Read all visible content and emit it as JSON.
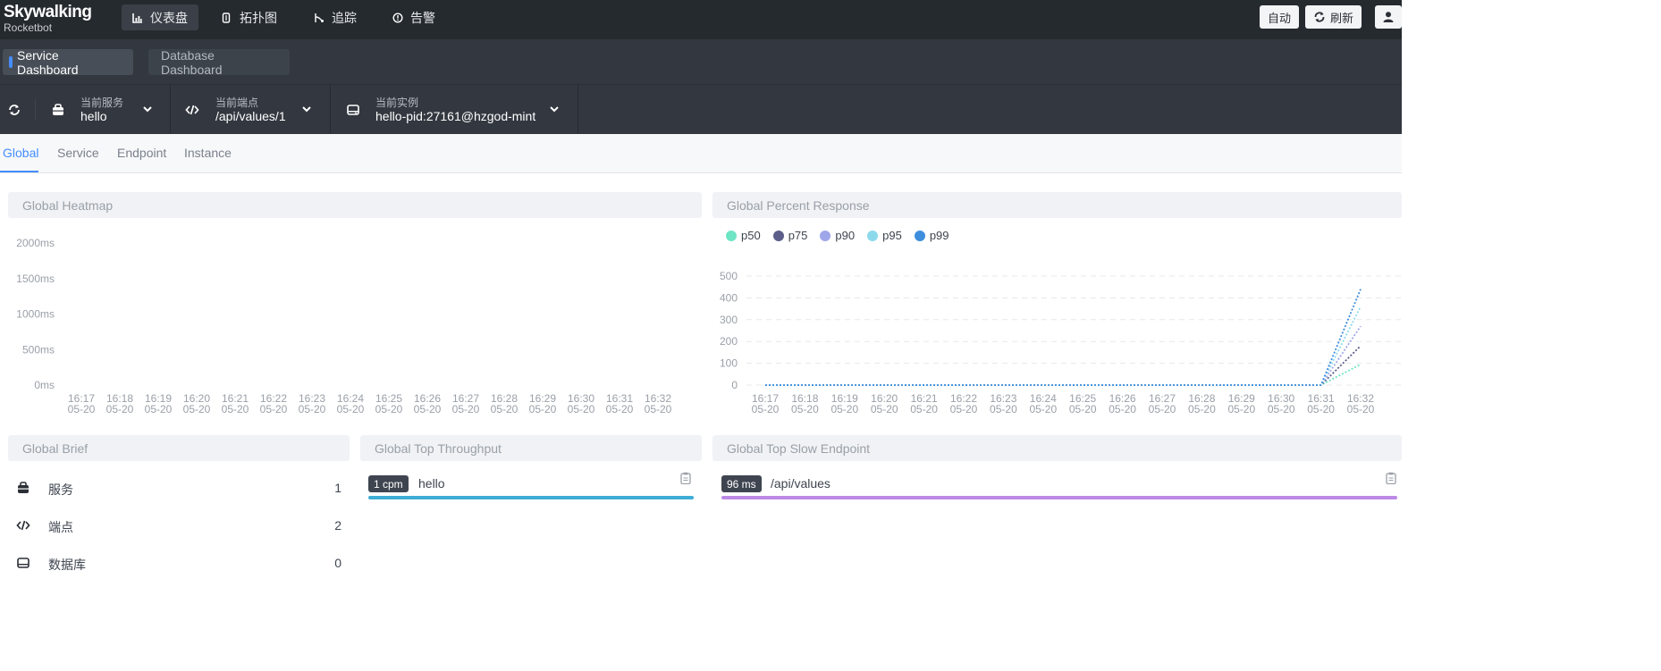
{
  "app": {
    "brand": "Skywalking",
    "subtitle": "Rocketbot"
  },
  "nav": {
    "items": [
      {
        "label": "仪表盘",
        "icon": "dashboard-icon",
        "active": true
      },
      {
        "label": "拓扑图",
        "icon": "topology-icon",
        "active": false
      },
      {
        "label": "追踪",
        "icon": "trace-icon",
        "active": false
      },
      {
        "label": "告警",
        "icon": "alarm-icon",
        "active": false
      }
    ],
    "auto_label": "自动",
    "refresh_label": "刷新"
  },
  "dashboards": {
    "tabs": [
      "Service Dashboard",
      "Database Dashboard"
    ],
    "active": 0
  },
  "selectors": {
    "service": {
      "label": "当前服务",
      "value": "hello"
    },
    "endpoint": {
      "label": "当前端点",
      "value": "/api/values/1"
    },
    "instance": {
      "label": "当前实例",
      "value": "hello-pid:27161@hzgod-mint"
    }
  },
  "subtabs": [
    "Global",
    "Service",
    "Endpoint",
    "Instance"
  ],
  "panels": {
    "heatmap_title": "Global Heatmap",
    "percent_title": "Global Percent Response",
    "brief_title": "Global Brief",
    "throughput_title": "Global Top Throughput",
    "slow_title": "Global Top Slow Endpoint"
  },
  "colors": {
    "p50": "#6ee5c4",
    "p75": "#5b5e8a",
    "p90": "#9fa6e9",
    "p95": "#8dd9ec",
    "p99": "#3e8ede",
    "throughput_bar": "#3eaed6",
    "slow_bar": "#bc8ae6",
    "accent": "#448dfe"
  },
  "chart_data": [
    {
      "type": "heatmap",
      "title": "Global Heatmap",
      "y_ticks": [
        "2000ms",
        "1500ms",
        "1000ms",
        "500ms",
        "0ms"
      ],
      "x_times": [
        "16:17",
        "16:18",
        "16:19",
        "16:20",
        "16:21",
        "16:22",
        "16:23",
        "16:24",
        "16:25",
        "16:26",
        "16:27",
        "16:28",
        "16:29",
        "16:30",
        "16:31",
        "16:32"
      ],
      "x_date": "05-20",
      "values": []
    },
    {
      "type": "line",
      "title": "Global Percent Response",
      "x_times": [
        "16:17",
        "16:18",
        "16:19",
        "16:20",
        "16:21",
        "16:22",
        "16:23",
        "16:24",
        "16:25",
        "16:26",
        "16:27",
        "16:28",
        "16:29",
        "16:30",
        "16:31",
        "16:32"
      ],
      "x_date": "05-20",
      "ylim": [
        0,
        500
      ],
      "y_ticks": [
        0,
        100,
        200,
        300,
        400,
        500
      ],
      "series": [
        {
          "name": "p50",
          "values": [
            0,
            0,
            0,
            0,
            0,
            0,
            0,
            0,
            0,
            0,
            0,
            0,
            0,
            0,
            0,
            95
          ]
        },
        {
          "name": "p75",
          "values": [
            0,
            0,
            0,
            0,
            0,
            0,
            0,
            0,
            0,
            0,
            0,
            0,
            0,
            0,
            0,
            180
          ]
        },
        {
          "name": "p90",
          "values": [
            0,
            0,
            0,
            0,
            0,
            0,
            0,
            0,
            0,
            0,
            0,
            0,
            0,
            0,
            0,
            270
          ]
        },
        {
          "name": "p95",
          "values": [
            0,
            0,
            0,
            0,
            0,
            0,
            0,
            0,
            0,
            0,
            0,
            0,
            0,
            0,
            0,
            360
          ]
        },
        {
          "name": "p99",
          "values": [
            0,
            0,
            0,
            0,
            0,
            0,
            0,
            0,
            0,
            0,
            0,
            0,
            0,
            0,
            0,
            440
          ]
        }
      ]
    }
  ],
  "brief": [
    {
      "icon": "service-icon",
      "label": "服务",
      "value": "1"
    },
    {
      "icon": "endpoint-icon",
      "label": "端点",
      "value": "2"
    },
    {
      "icon": "database-icon",
      "label": "数据库",
      "value": "0"
    }
  ],
  "top_throughput": [
    {
      "badge": "1 cpm",
      "name": "hello",
      "ratio": 1.0
    }
  ],
  "top_slow": [
    {
      "badge": "96 ms",
      "name": "/api/values",
      "ratio": 1.0
    }
  ]
}
